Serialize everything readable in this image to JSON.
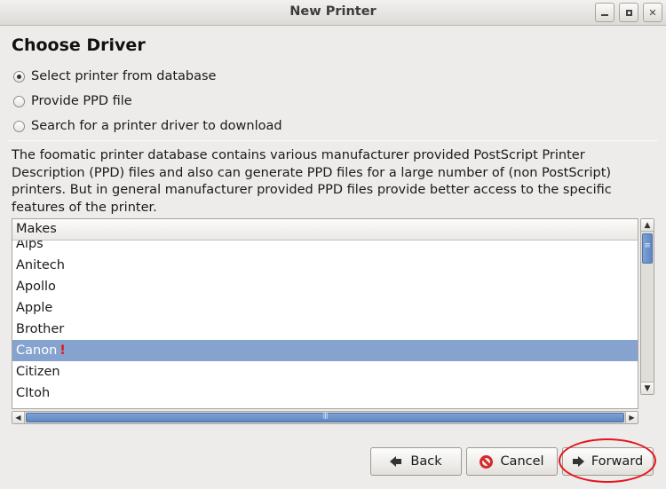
{
  "window": {
    "title": "New Printer",
    "controls": [
      "minimize-icon",
      "maximize-icon",
      "close-icon"
    ]
  },
  "heading": "Choose Driver",
  "options": [
    {
      "label": "Select printer from database",
      "checked": true
    },
    {
      "label": "Provide PPD file",
      "checked": false
    },
    {
      "label": "Search for a printer driver to download",
      "checked": false
    }
  ],
  "description": "The foomatic printer database contains various manufacturer provided PostScript Printer Description (PPD) files and also can generate PPD files for a large number of (non PostScript) printers. But in general manufacturer provided PPD files provide better access to the specific features of the printer.",
  "makes": {
    "header": "Makes",
    "items": [
      "Alps",
      "Anitech",
      "Apollo",
      "Apple",
      "Brother",
      "Canon",
      "Citizen",
      "CItoh"
    ],
    "selected": "Canon",
    "selected_marker": "!"
  },
  "buttons": {
    "back": "Back",
    "cancel": "Cancel",
    "forward": "Forward"
  },
  "colors": {
    "selection": "#86a3cf",
    "annotation": "#e3151d",
    "marker": "#e8131a"
  }
}
